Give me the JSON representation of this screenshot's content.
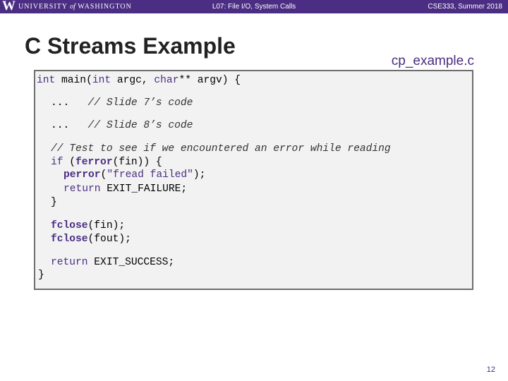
{
  "header": {
    "logo_letter": "W",
    "university_part1": "UNIVERSITY",
    "university_of": "of",
    "university_part2": "WASHINGTON",
    "lecture": "L07: File I/O, System Calls",
    "course": "CSE333, Summer 2018"
  },
  "slide": {
    "title": "C Streams Example",
    "filename": "cp_example.c",
    "page_number": "12"
  },
  "code": {
    "l01_kw1": "int",
    "l01_a": " main(",
    "l01_kw2": "int",
    "l01_b": " argc, ",
    "l01_kw3": "char",
    "l01_c": "** argv) {",
    "l02_a": "...   ",
    "l02_cm": "// Slide 7’s code",
    "l03_a": "...   ",
    "l03_cm": "// Slide 8’s code",
    "l04_cm": "// Test to see if we encountered an error while reading",
    "l05_kw": "if",
    "l05_a": " (",
    "l05_fn": "ferror",
    "l05_b": "(fin)) {",
    "l06_fn": "perror",
    "l06_a": "(",
    "l06_str": "\"fread failed\"",
    "l06_b": ");",
    "l07_kw": "return",
    "l07_a": " EXIT_FAILURE;",
    "l08_a": "}",
    "l09_fn": "fclose",
    "l09_a": "(fin);",
    "l10_fn": "fclose",
    "l10_a": "(fout);",
    "l11_kw": "return",
    "l11_a": " EXIT_SUCCESS;",
    "l12_a": "}"
  }
}
